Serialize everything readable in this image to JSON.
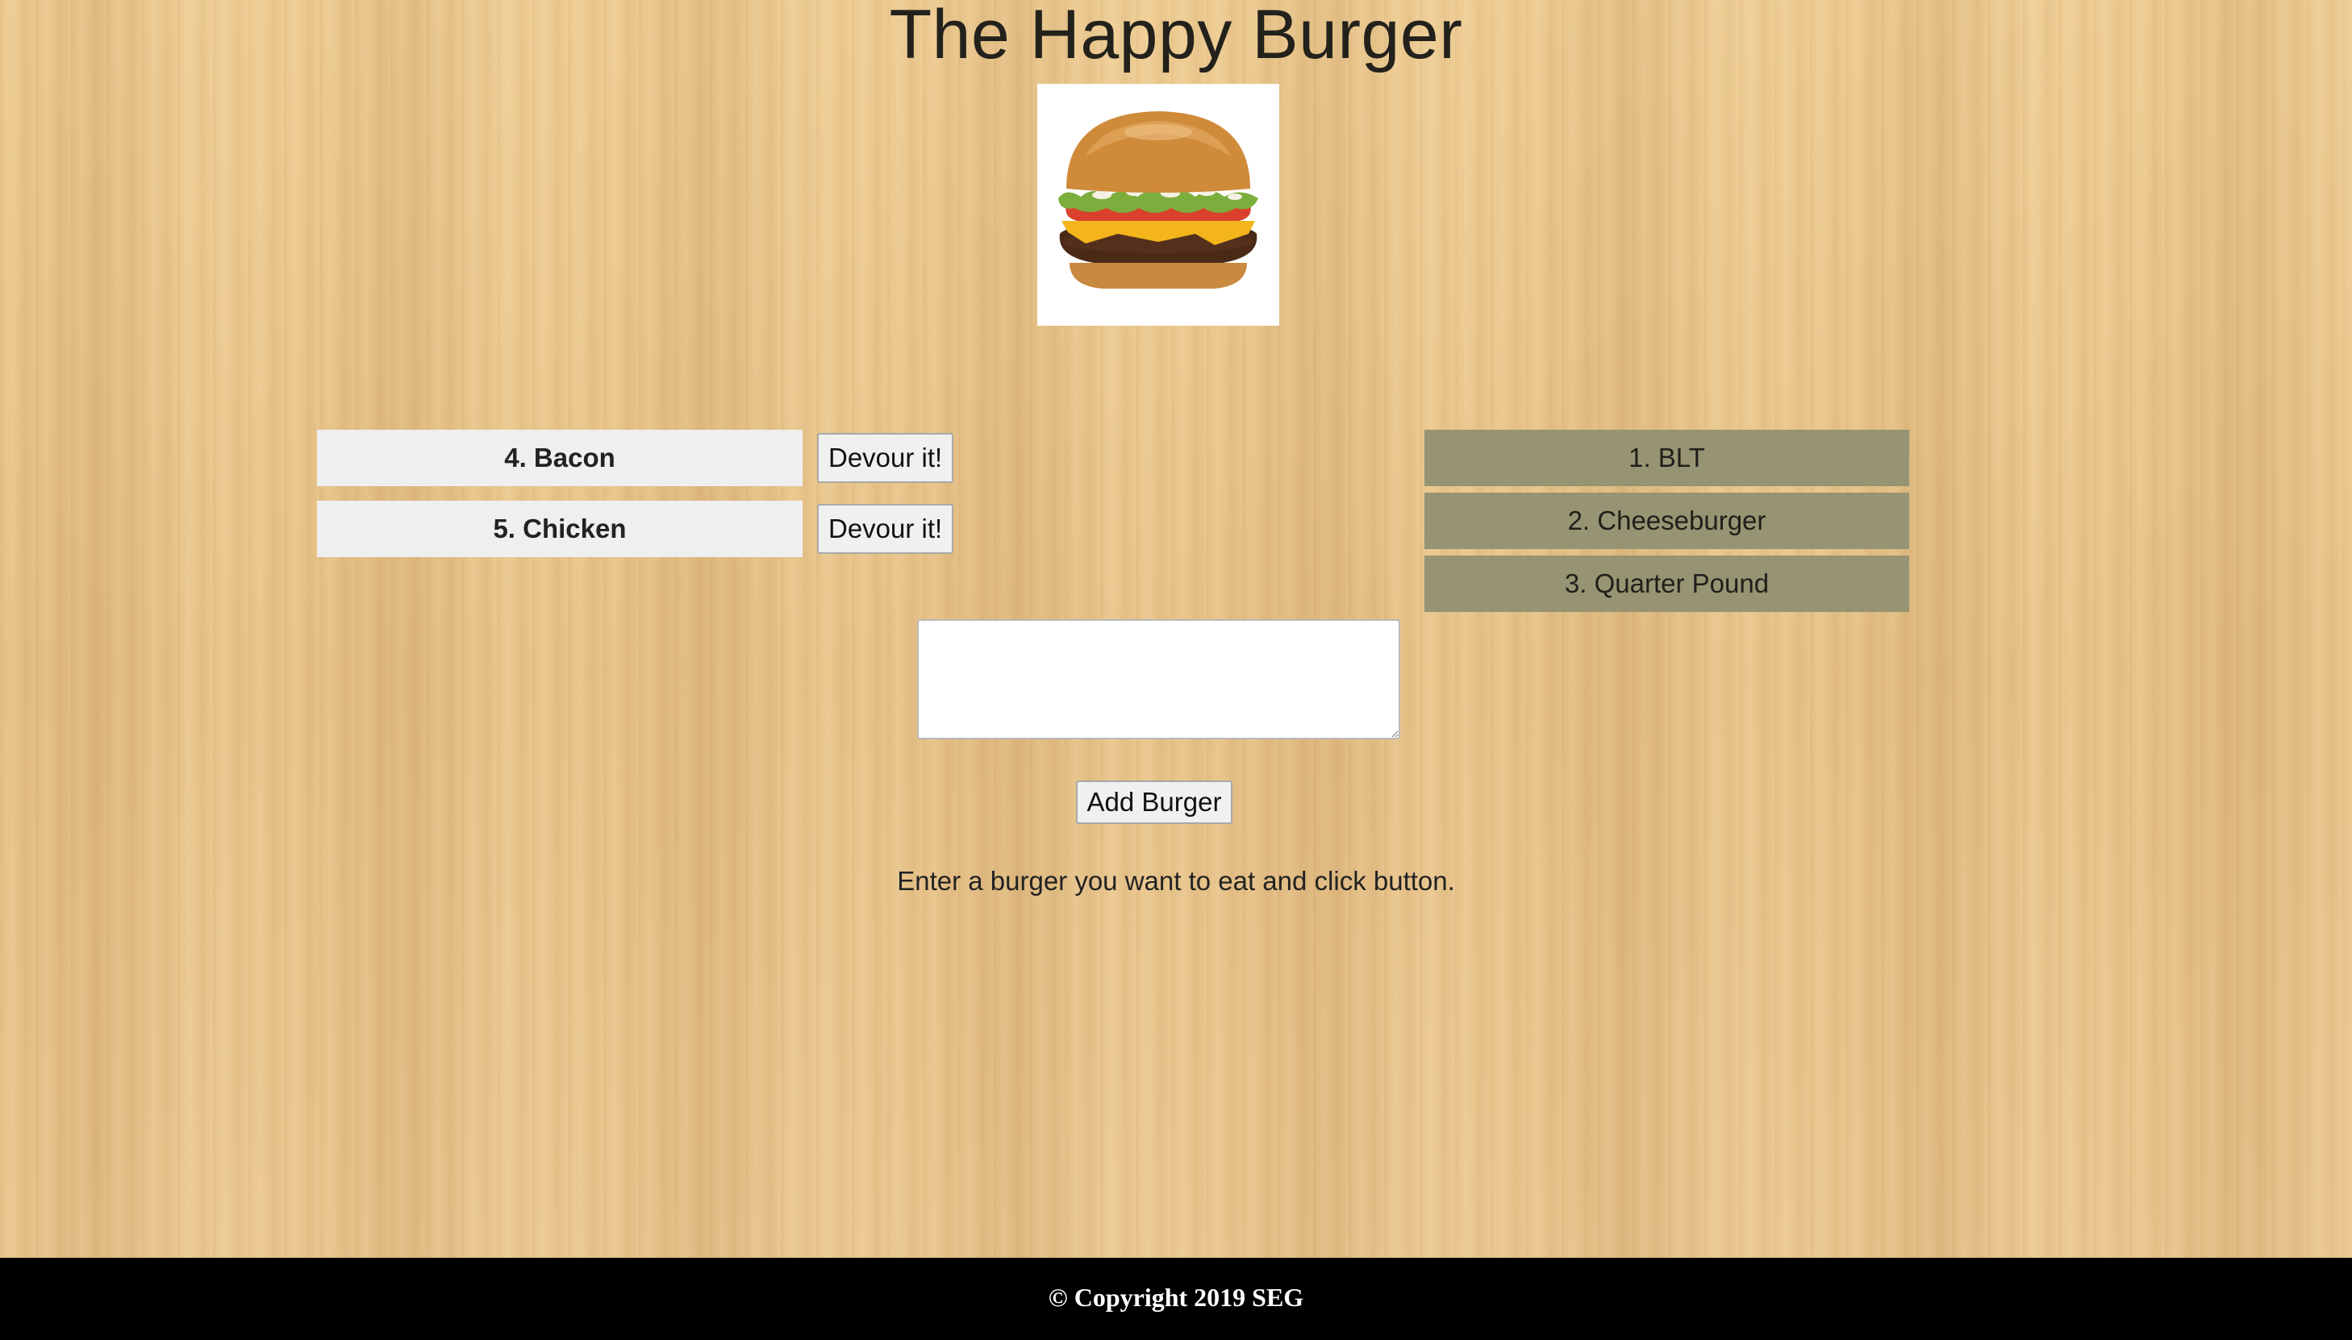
{
  "header": {
    "title": "The Happy Burger"
  },
  "hero": {
    "image_icon": "burger-photo"
  },
  "waiting": {
    "items": [
      {
        "label": "4. Bacon",
        "button_label": "Devour it!"
      },
      {
        "label": "5. Chicken",
        "button_label": "Devour it!"
      }
    ]
  },
  "devoured": {
    "items": [
      {
        "label": "1. BLT"
      },
      {
        "label": "2. Cheeseburger"
      },
      {
        "label": "3. Quarter Pound"
      }
    ]
  },
  "form": {
    "input_value": "",
    "add_button_label": "Add Burger",
    "instructions": "Enter a burger you want to eat and click button."
  },
  "footer": {
    "text": "© Copyright 2019 SEG"
  },
  "colors": {
    "waiting_bg": "#efefef",
    "devoured_bg": "#969472",
    "footer_bg": "#000000",
    "page_bg": "#e8c489"
  }
}
